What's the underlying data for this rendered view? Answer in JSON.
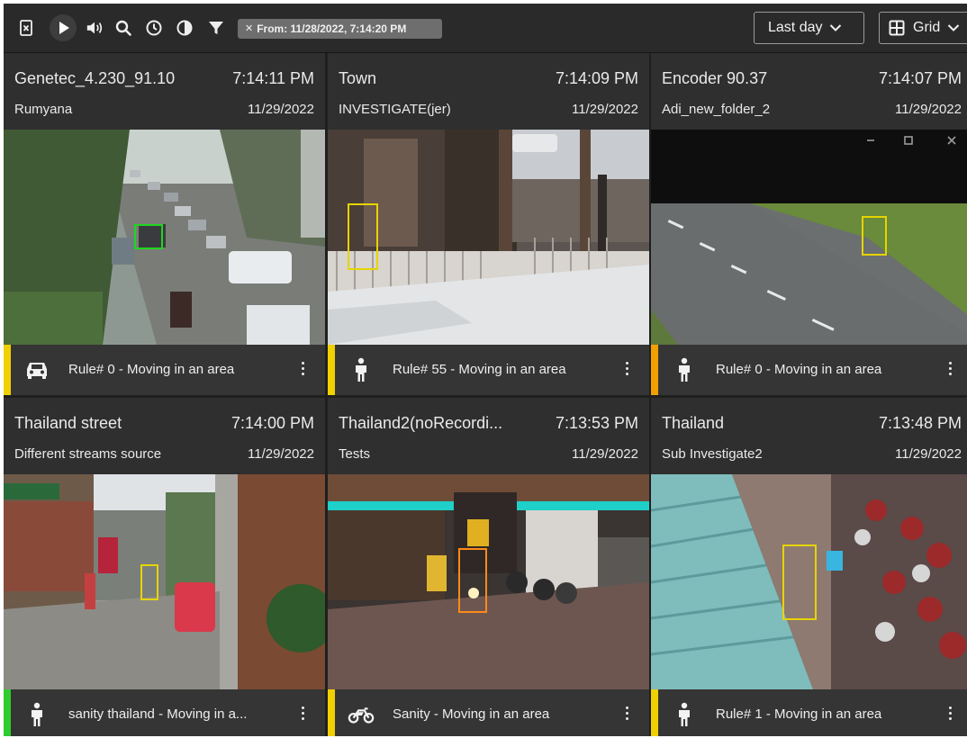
{
  "toolbar": {
    "icons": [
      "export-excel-icon",
      "play-icon",
      "volume-icon",
      "search-icon",
      "clock-icon",
      "contrast-icon",
      "filter-icon"
    ],
    "filter_chip": {
      "close": "✕",
      "label": "From: 11/28/2022, 7:14:20 PM"
    },
    "range_dropdown": "Last day",
    "view_dropdown": "Grid"
  },
  "colors": {
    "stripe_yellow": "#f0d000",
    "stripe_orange": "#f0a000",
    "stripe_green": "#2ecc2e",
    "detection_green": "#1fd61f",
    "detection_yellow": "#e6d400",
    "detection_orange": "#ff8a1a"
  },
  "cells": [
    {
      "name": "Genetec_4.230_91.10",
      "time": "7:14:11 PM",
      "group": "Rumyana",
      "date": "11/29/2022",
      "rule": "Rule# 0 - Moving in an area",
      "object": "car-icon",
      "stripe": "#f0d000"
    },
    {
      "name": "Town",
      "time": "7:14:09 PM",
      "group": "INVESTIGATE(jer)",
      "date": "11/29/2022",
      "rule": "Rule# 55 - Moving in an area",
      "object": "person-icon",
      "stripe": "#f0d000"
    },
    {
      "name": "Encoder 90.37",
      "time": "7:14:07 PM",
      "group": "Adi_new_folder_2",
      "date": "11/29/2022",
      "rule": "Rule# 0 - Moving in an area",
      "object": "person-icon",
      "stripe": "#f0a000"
    },
    {
      "name": "Thailand street",
      "time": "7:14:00 PM",
      "group": "Different streams source",
      "date": "11/29/2022",
      "rule": "sanity thailand - Moving in a...",
      "object": "person-icon",
      "stripe": "#2ecc2e"
    },
    {
      "name": "Thailand2(noRecordi...",
      "time": "7:13:53 PM",
      "group": "Tests",
      "date": "11/29/2022",
      "rule": "Sanity - Moving in an area",
      "object": "motorcycle-icon",
      "stripe": "#f0d000"
    },
    {
      "name": "Thailand",
      "time": "7:13:48 PM",
      "group": "Sub Investigate2",
      "date": "11/29/2022",
      "rule": "Rule# 1 - Moving in an area",
      "object": "person-icon",
      "stripe": "#f0d000"
    }
  ]
}
